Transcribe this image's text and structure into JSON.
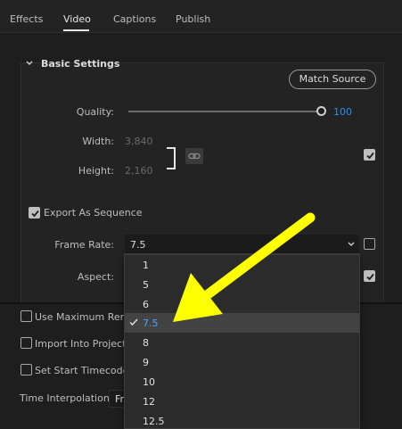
{
  "tabs": [
    "Effects",
    "Video",
    "Captions",
    "Publish"
  ],
  "active_tab": "Video",
  "section": {
    "title": "Basic Settings",
    "match_source_label": "Match Source"
  },
  "quality": {
    "label": "Quality:",
    "value": "100",
    "fraction": 1.0
  },
  "width": {
    "label": "Width:",
    "value": "3,840"
  },
  "height": {
    "label": "Height:",
    "value": "2,160"
  },
  "export_sequence": {
    "label": "Export As Sequence",
    "checked": true
  },
  "frame_rate": {
    "label": "Frame Rate:",
    "value": "7.5"
  },
  "aspect": {
    "label": "Aspect:"
  },
  "dropdown_options": [
    "1",
    "5",
    "6",
    "7.5",
    "8",
    "9",
    "10",
    "12",
    "12.5"
  ],
  "selected_option": "7.5",
  "lower": {
    "use_max_render": "Use Maximum Rend",
    "import_project": "Import Into Project",
    "set_start_timecode": "Set Start Timecode",
    "time_interpolation_label": "Time Interpolation:",
    "time_interpolation_value": "Fr"
  },
  "colors": {
    "accent_blue": "#2d8ceb",
    "arrow_yellow": "#ffff00",
    "background": "#1e1e1e"
  },
  "icons": [
    "chevron-down-icon",
    "link-icon",
    "checkmark-icon",
    "arrow-annotation"
  ]
}
